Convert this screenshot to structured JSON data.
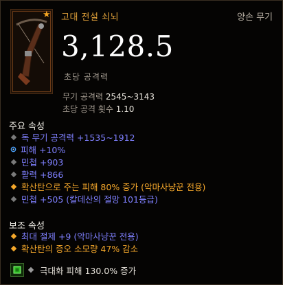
{
  "item": {
    "name": "고대 전설 쇠뇌",
    "type": "양손 무기",
    "dps": "3,128.5",
    "dps_label": "초당 공격력"
  },
  "weapon_stats": {
    "damage_label": "무기 공격력",
    "damage_value": "2545~3143",
    "aps_label": "초당 공격 횟수",
    "aps_value": "1.10"
  },
  "primary": {
    "title": "주요 속성",
    "affixes": [
      {
        "text": "독 무기 공격력 +1535~1912",
        "color": "blue",
        "bullet": "diamond-gray"
      },
      {
        "text": "피해 +10%",
        "color": "blue",
        "bullet": "enchant-blue"
      },
      {
        "text": "민첩 +903",
        "color": "blue",
        "bullet": "diamond-gray"
      },
      {
        "text": "활력 +866",
        "color": "blue",
        "bullet": "diamond-gray"
      },
      {
        "text": "확산탄으로 주는 피해 80% 증가 (악마사냥꾼 전용)",
        "color": "orange",
        "bullet": "diamond-orange"
      },
      {
        "text": "민첩 +505 (칼데산의 절망 101등급)",
        "color": "blue",
        "bullet": "diamond-gray"
      }
    ]
  },
  "secondary": {
    "title": "보조 속성",
    "affixes": [
      {
        "text": "최대 절제 +9 (악마사냥꾼 전용)",
        "color": "blue",
        "bullet": "diamond-orange"
      },
      {
        "text": "확산탄의 증오 소모량 47% 감소",
        "color": "orange",
        "bullet": "diamond-orange"
      }
    ]
  },
  "socket": {
    "gem_icon": "emerald-gem-icon",
    "text": "극대화 피해 130.0% 증가"
  },
  "colors": {
    "legendary": "#e0a13a",
    "magic_blue": "#7f80ff",
    "legendary_affix": "#f4a72b"
  }
}
